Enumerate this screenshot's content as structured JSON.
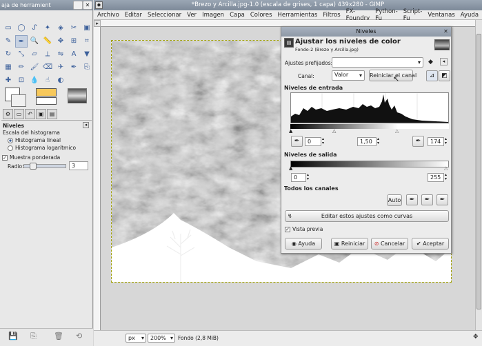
{
  "toolbox": {
    "title": "aja de herramient",
    "options_title": "Niveles",
    "histogram_scale_label": "Escala del histograma",
    "histogram_linear": "Histograma lineal",
    "histogram_log": "Histograma logarítmico",
    "sample_merged": "Muestra ponderada",
    "radius_label": "Radio:",
    "radius_value": "3"
  },
  "window": {
    "title": "*Brezo y Arcilla.jpg-1.0 (escala de grises, 1 capa) 439x280 - GIMP"
  },
  "menu": [
    "Archivo",
    "Editar",
    "Seleccionar",
    "Ver",
    "Imagen",
    "Capa",
    "Colores",
    "Herramientas",
    "Filtros",
    "FX-Foundry",
    "Python-Fu",
    "Script-Fu",
    "Ventanas",
    "Ayuda"
  ],
  "status": {
    "unit": "px",
    "zoom": "200%",
    "info": "Fondo (2,8 MiB)"
  },
  "dialog": {
    "title": "Niveles",
    "header_title": "Ajustar los niveles de color",
    "header_subtitle": "Fondo-2 (Brezo y Arcilla.jpg)",
    "presets_label": "Ajustes prefijados:",
    "presets_value": "",
    "channel_label": "Canal:",
    "channel_value": "Valor",
    "reset_channel": "Reiniciar el canal",
    "input_levels": "Niveles de entrada",
    "input_low": "0",
    "input_gamma": "1,50",
    "input_high": "174",
    "output_levels": "Niveles de salida",
    "output_low": "0",
    "output_high": "255",
    "all_channels": "Todos los canales",
    "auto": "Auto",
    "edit_curves": "Editar estos ajustes como curvas",
    "preview": "Vista previa",
    "help": "Ayuda",
    "reset": "Reiniciar",
    "cancel": "Cancelar",
    "ok": "Aceptar"
  },
  "colors": {
    "titlebar": "#8d98a6",
    "selection": "#a0a000"
  },
  "icons": [
    "rect-select-icon",
    "ellipse-select-icon",
    "lasso-icon",
    "fuzzy-select-icon",
    "color-select-icon",
    "scissors-icon",
    "foreground-select-icon",
    "paths-icon",
    "color-picker-icon",
    "zoom-icon",
    "measure-icon",
    "move-icon",
    "align-icon",
    "crop-icon",
    "rotate-icon",
    "scale-icon",
    "shear-icon",
    "perspective-icon",
    "flip-icon",
    "text-icon",
    "bucket-fill-icon",
    "blend-icon",
    "pencil-icon",
    "paintbrush-icon",
    "eraser-icon",
    "airbrush-icon",
    "ink-icon",
    "clone-icon",
    "heal-icon",
    "perspective-clone-icon",
    "blur-icon",
    "smudge-icon",
    "dodge-burn-icon"
  ]
}
